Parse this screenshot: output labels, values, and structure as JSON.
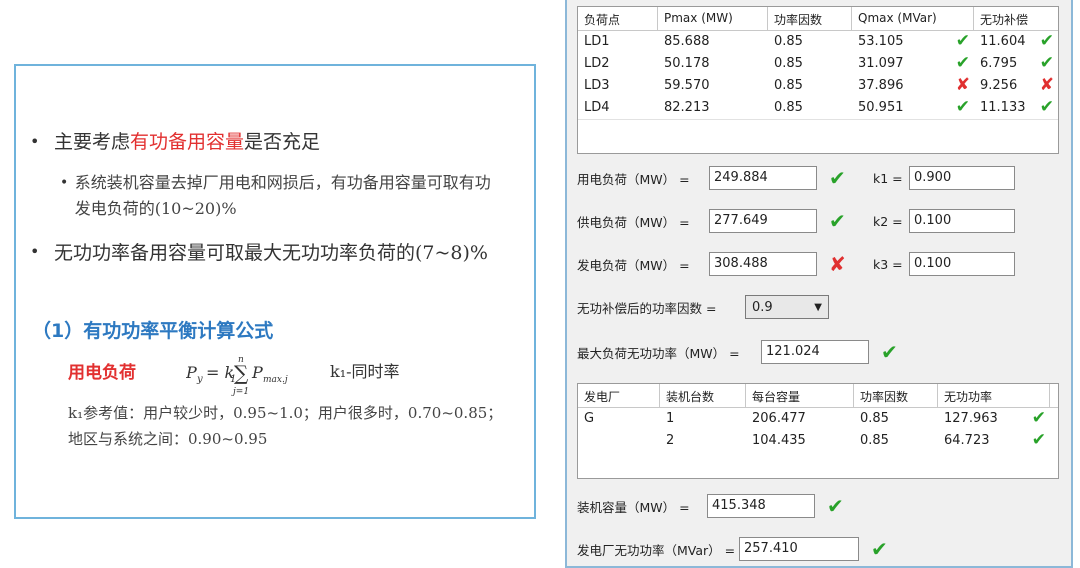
{
  "slide": {
    "bullet1_pre": "主要考虑",
    "bullet1_highlight": "有功备用容量",
    "bullet1_post": "是否充足",
    "bullet2": "系统装机容量去掉厂用电和网损后，有功备用容量可取有功发电负荷的(10~20)%",
    "bullet3": "无功功率备用容量可取最大无功功率负荷的(7~8)%",
    "heading": "（1）有功功率平衡计算公式",
    "formula_label": "用电负荷",
    "formula_lhs": "P",
    "formula_lhs_sub": "y",
    "formula_eq": "= k",
    "formula_k_sub": "1",
    "formula_sum_top": "n",
    "formula_sum_bottom": "j=1",
    "formula_term": "P",
    "formula_term_sub": "max.j",
    "k1_desc": "k₁-同时率",
    "k1_ref": "k₁参考值：用户较少时，0.95~1.0；用户很多时，0.70~0.85；地区与系统之间：0.90~0.95"
  },
  "load_table": {
    "headers": [
      "负荷点",
      "Pmax (MW)",
      "功率因数",
      "Qmax (MVar)",
      "无功补偿"
    ],
    "rows": [
      {
        "name": "LD1",
        "pmax": "85.688",
        "pf": "0.85",
        "qmax": "53.105",
        "q_ok": "✔",
        "comp": "11.604",
        "c_ok": "✔"
      },
      {
        "name": "LD2",
        "pmax": "50.178",
        "pf": "0.85",
        "qmax": "31.097",
        "q_ok": "✔",
        "comp": "6.795",
        "c_ok": "✔"
      },
      {
        "name": "LD3",
        "pmax": "59.570",
        "pf": "0.85",
        "qmax": "37.896",
        "q_ok": "✘",
        "comp": "9.256",
        "c_ok": "✘"
      },
      {
        "name": "LD4",
        "pmax": "82.213",
        "pf": "0.85",
        "qmax": "50.951",
        "q_ok": "✔",
        "comp": "11.133",
        "c_ok": "✔"
      }
    ]
  },
  "fields": {
    "use_load_label": "用电负荷（MW） =",
    "use_load_value": "249.884",
    "use_load_mark": "✔",
    "k1_label": "k1 =",
    "k1_value": "0.900",
    "supply_load_label": "供电负荷（MW） =",
    "supply_load_value": "277.649",
    "supply_load_mark": "✔",
    "k2_label": "k2 =",
    "k2_value": "0.100",
    "gen_load_label": "发电负荷（MW） =",
    "gen_load_value": "308.488",
    "gen_load_mark": "✘",
    "k3_label": "k3 =",
    "k3_value": "0.100",
    "comp_pf_label": "无功补偿后的功率因数 =",
    "comp_pf_value": "0.9",
    "max_q_label": "最大负荷无功功率（MW） =",
    "max_q_value": "121.024",
    "max_q_mark": "✔"
  },
  "plant_table": {
    "headers": [
      "发电厂",
      "装机台数",
      "每台容量",
      "功率因数",
      "无功功率"
    ],
    "rows": [
      {
        "plant": "G",
        "units": "1",
        "cap": "206.477",
        "pf": "0.85",
        "q": "127.963",
        "ok": "✔"
      },
      {
        "plant": "",
        "units": "2",
        "cap": "104.435",
        "pf": "0.85",
        "q": "64.723",
        "ok": "✔"
      }
    ]
  },
  "bottom": {
    "installed_label": "装机容量（MW） =",
    "installed_value": "415.348",
    "installed_mark": "✔",
    "plant_q_label": "发电厂无功功率（MVar） =",
    "plant_q_value": "257.410",
    "plant_q_mark": "✔"
  },
  "colors": {
    "check": "#29a22a",
    "cross": "#e03030",
    "highlight_red": "#e23030",
    "heading_blue": "#2d79c1",
    "slide_border": "#6fb3dc"
  }
}
